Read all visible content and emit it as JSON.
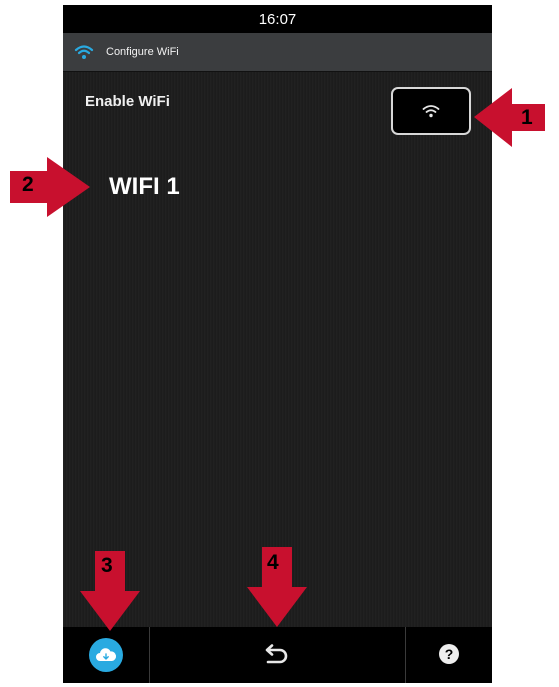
{
  "status_bar": {
    "time": "16:07"
  },
  "title_bar": {
    "icon": "wifi-icon",
    "title": "Configure WiFi"
  },
  "settings": {
    "enable_label": "Enable WiFi",
    "toggle_icon": "wifi-icon"
  },
  "network": {
    "name": "WIFI 1"
  },
  "bottom_bar": {
    "left_icon": "cloud-icon",
    "center_icon": "back-arrow-icon",
    "right_icon": "help-icon",
    "help_label": "?"
  },
  "callouts": [
    "1",
    "2",
    "3",
    "4"
  ],
  "colors": {
    "callout_arrow": "#c8102e",
    "accent": "#29aae1",
    "screen_bg": "#1c1c1c",
    "title_bar_bg": "#3b3d3f"
  }
}
